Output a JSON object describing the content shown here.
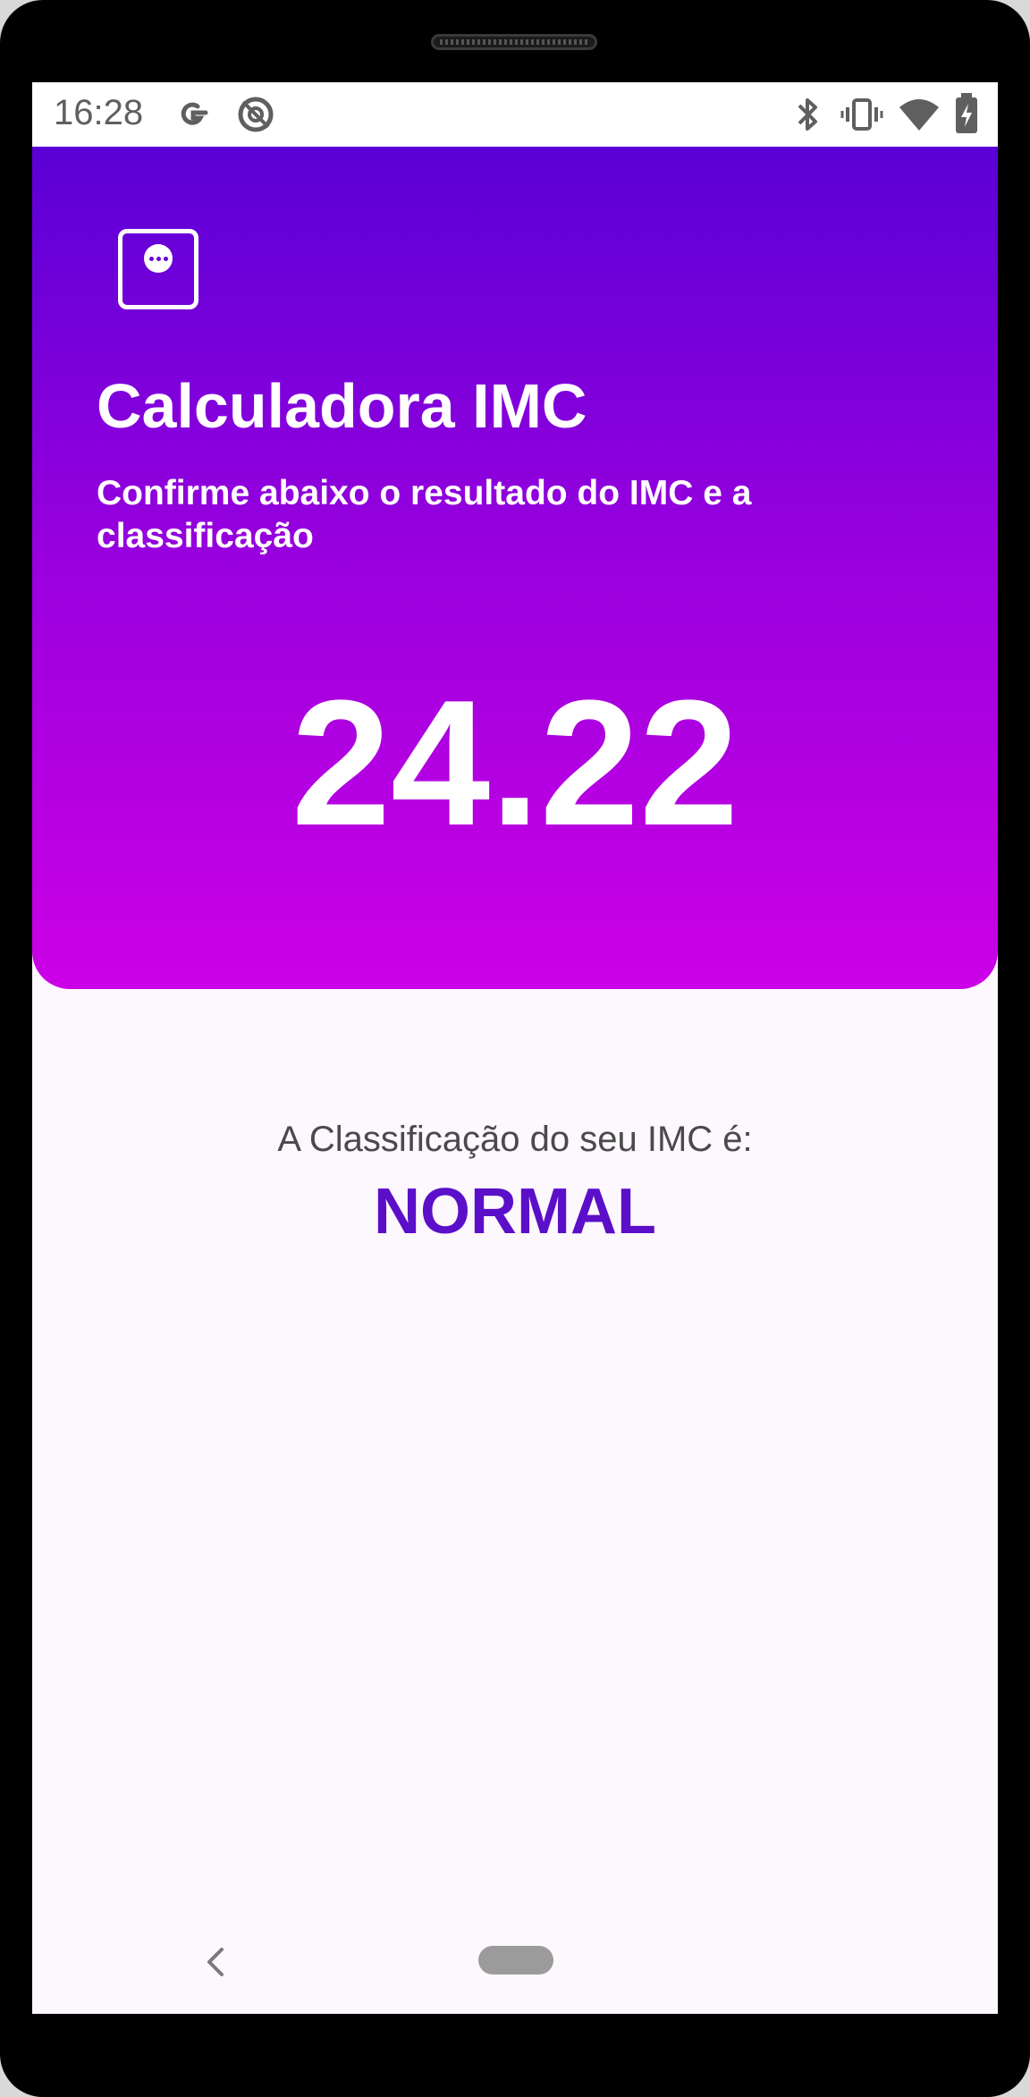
{
  "status_bar": {
    "time": "16:28",
    "left_icons": [
      "google-icon",
      "no-sim-icon"
    ],
    "right_icons": [
      "bluetooth-icon",
      "vibrate-icon",
      "wifi-icon",
      "battery-icon"
    ]
  },
  "header": {
    "title": "Calculadora IMC",
    "subtitle": "Confirme abaixo o resultado do IMC e a classificação",
    "bmi_value": "24.22",
    "gradient_top": "#5a00d6",
    "gradient_bottom": "#cc00e6"
  },
  "result": {
    "label": "A Classificação do seu IMC é:",
    "classification": "NORMAL",
    "classification_color": "#5b0fc8"
  },
  "nav_bar": {
    "back_icon": "chevron-left-icon",
    "home_icon": "home-pill-icon"
  }
}
